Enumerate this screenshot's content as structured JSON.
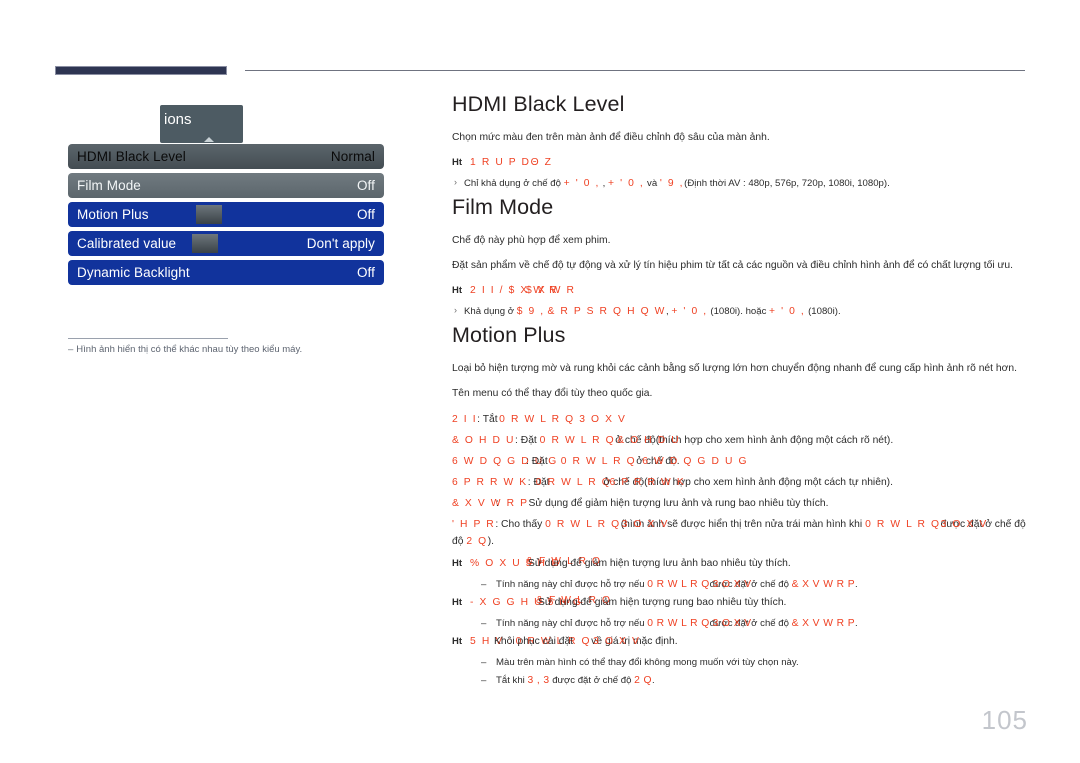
{
  "page": {
    "number": "105"
  },
  "osd": {
    "header_label": "ions",
    "caret_icon": "up-caret-icon",
    "rows": [
      {
        "label": "HDMI Black Level",
        "value": "Normal",
        "state": "selected"
      },
      {
        "label": "Film Mode",
        "value": "Off",
        "state": "grey"
      },
      {
        "label": "Motion Plus",
        "value": "Off",
        "state": "blue"
      },
      {
        "label": "Calibrated value",
        "value": "Don't apply",
        "state": "blue"
      },
      {
        "label": "Dynamic Backlight",
        "value": "Off",
        "state": "blue"
      }
    ],
    "note_dash": "‒",
    "note": "Hình ảnh hiển thị có thể khác nhau tùy theo kiểu máy."
  },
  "sections": {
    "hdmi_black_level": {
      "title": "HDMI Black Level",
      "body": "Chọn mức màu đen trên màn ảnh để điều chỉnh độ sâu của màn ảnh.",
      "ht_marker": "Ht",
      "ht_value": "1 R U P DΘ Z",
      "note_prefix": "Chỉ khả dụng ở chế độ",
      "note_r1": "+ ' 0 ,",
      "note_mid1": ",",
      "note_r2": "+ ' 0 ,",
      "note_mid2": "và",
      "note_r3": "' 9 ,",
      "note_tail": "(Định thời AV : 480p, 576p, 720p, 1080i, 1080p)."
    },
    "film_mode": {
      "title": "Film Mode",
      "body1": "Chế độ này phù hợp để xem phim.",
      "body2": "Đặt sản phẩm về chế độ tự động và xử lý tín hiệu phim từ tất cả các nguồn và điều chỉnh hình ảnh để có chất lượng tối ưu.",
      "ht_marker": "Ht",
      "ht_value": "2 I I / $ X W R",
      "ht_value_over": "$ X W R",
      "note_prefix": "Khả dụng ở",
      "note_r1": "$ 9 ,",
      "note_r2": "& R P S R Q H Q W",
      "note_mid": ",",
      "note_r3": "+ ' 0 ,",
      "note_t1": "(1080i). hoặc",
      "note_r4": "+ ' 0 ,",
      "note_t2": "(1080i)."
    },
    "motion_plus": {
      "title": "Motion Plus",
      "body1": "Loại bỏ hiện tượng mờ và rung khỏi các cảnh bằng số lượng lớn hơn chuyển động nhanh để cung cấp hình ảnh rõ nét hơn.",
      "body2": "Tên menu có thể thay đổi tùy theo quốc gia.",
      "options": [
        {
          "key": "2 I I",
          "sep": ": Tắt",
          "red_over": "0 R W L R Q   3 O X V",
          "tail": ""
        },
        {
          "key": "& O H D U",
          "sep": ": Đặt",
          "red_a": "0 R W L R Q",
          "mid": "ở chế độ",
          "red_b": "& O H D U",
          "tail": "(thích hợp cho xem hình ảnh động một cách rõ nét)."
        },
        {
          "key": "6 W D Q G D U G",
          "sep": ": Đặt",
          "red_a": "0 R W L R Q",
          "mid": "ở chế độ",
          "red_b": "6 W D Q G D U G",
          "tail": "."
        },
        {
          "key": "6 P R R W K",
          "sep": ": Đặt",
          "red_a": "0 R W L R Q",
          "mid": "ở chế độ",
          "red_b": "6 P R R W K",
          "tail": "(thích hợp cho xem hình ảnh động một cách tự nhiên)."
        },
        {
          "key": "& X V W R P",
          "sep": ":",
          "red_a": "",
          "mid": "Sử dụng để giảm hiện tượng lưu ảnh và rung bao nhiêu tùy thích.",
          "red_b": "",
          "tail": ""
        },
        {
          "key": "' H P R",
          "sep": ": Cho thấy",
          "red_a": "0 R W L R Q",
          "mid": "(hình ảnh sẽ được hiển thị trên nửa trái màn hình khi",
          "red_b": "0 R W L R Q",
          "tail": "được đặt ở chế độ"
        }
      ],
      "demo_tail_red": "2 Q",
      "demo_tail_text": "độ",
      "demo_tail_end": ").",
      "ht_items": [
        {
          "marker": "Ht",
          "red": "% O X U   5 H G",
          "red_over": "& F W L R Q",
          "text": "Sử dụng để giảm hiện tượng lưu ảnh bao nhiêu tùy thích.",
          "sub_pre": "Tính năng này chỉ được hỗ trợ nếu",
          "sub_red1": "0 R W L R Q",
          "sub_mid": "được đặt ở chế độ",
          "sub_red2": "& X V W R P",
          "sub_end": "."
        },
        {
          "marker": "Ht",
          "red": "- X G G H U   5 H G",
          "red_over": "& F W L R Q",
          "text": "Sử dụng để giảm hiện tượng rung bao nhiêu tùy thích.",
          "sub_pre": "Tính năng này chỉ được hỗ trợ nếu",
          "sub_red1": "0 R W L R Q",
          "sub_mid": "được đặt ở chế độ",
          "sub_red2": "& X V W R P",
          "sub_end": "."
        },
        {
          "marker": "Ht",
          "red": "5 H V :",
          "red_over": "",
          "text": "Khôi phục cài đặt",
          "sub_pre": "",
          "sub_red1": "0 R W L R Q",
          "sub_mid": "về giá trị mặc định.",
          "sub_red2": "",
          "sub_end": ""
        }
      ],
      "reset_extra_red": "3 O X V",
      "tail_notes": [
        "Màu trên màn hình có thể thay đổi không mong muốn với tùy chọn này.",
        ""
      ],
      "last_note_pre": "Tắt khi",
      "last_note_red1": "3 , 3",
      "last_note_mid": "được đặt ở chế độ",
      "last_note_red2": "2 Q",
      "last_note_end": "."
    }
  }
}
